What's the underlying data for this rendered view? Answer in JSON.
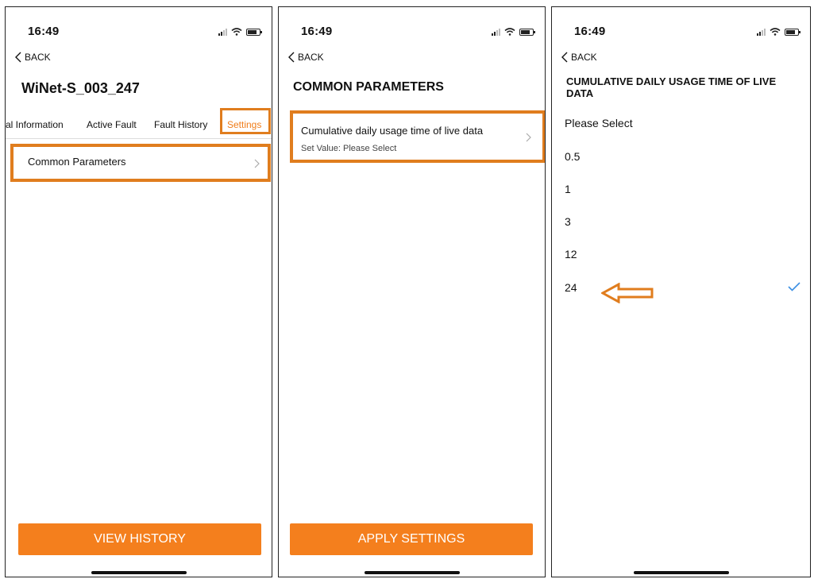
{
  "colors": {
    "accent": "#f47f1d",
    "highlight_box": "#e07d1e",
    "check": "#3b8fe3"
  },
  "status": {
    "time": "16:49"
  },
  "nav": {
    "back_label": "BACK"
  },
  "screen1": {
    "title": "WiNet-S_003_247",
    "tabs": [
      "ral Information",
      "Active Fault",
      "Fault History",
      "Settings"
    ],
    "active_tab": "Settings",
    "row_label": "Common Parameters",
    "button_label": "VIEW HISTORY"
  },
  "screen2": {
    "title": "COMMON PARAMETERS",
    "row_label": "Cumulative daily usage time of live data",
    "row_sub": "Set Value: Please Select",
    "button_label": "APPLY SETTINGS"
  },
  "screen3": {
    "title": "CUMULATIVE DAILY USAGE TIME OF LIVE DATA",
    "options": [
      "Please Select",
      "0.5",
      "1",
      "3",
      "12",
      "24"
    ],
    "selected": "24"
  },
  "icons": {
    "back": "chevron-left-icon",
    "row_arrow": "chevron-right-icon",
    "selected": "checkmark-icon",
    "pointer": "left-arrow-icon"
  }
}
